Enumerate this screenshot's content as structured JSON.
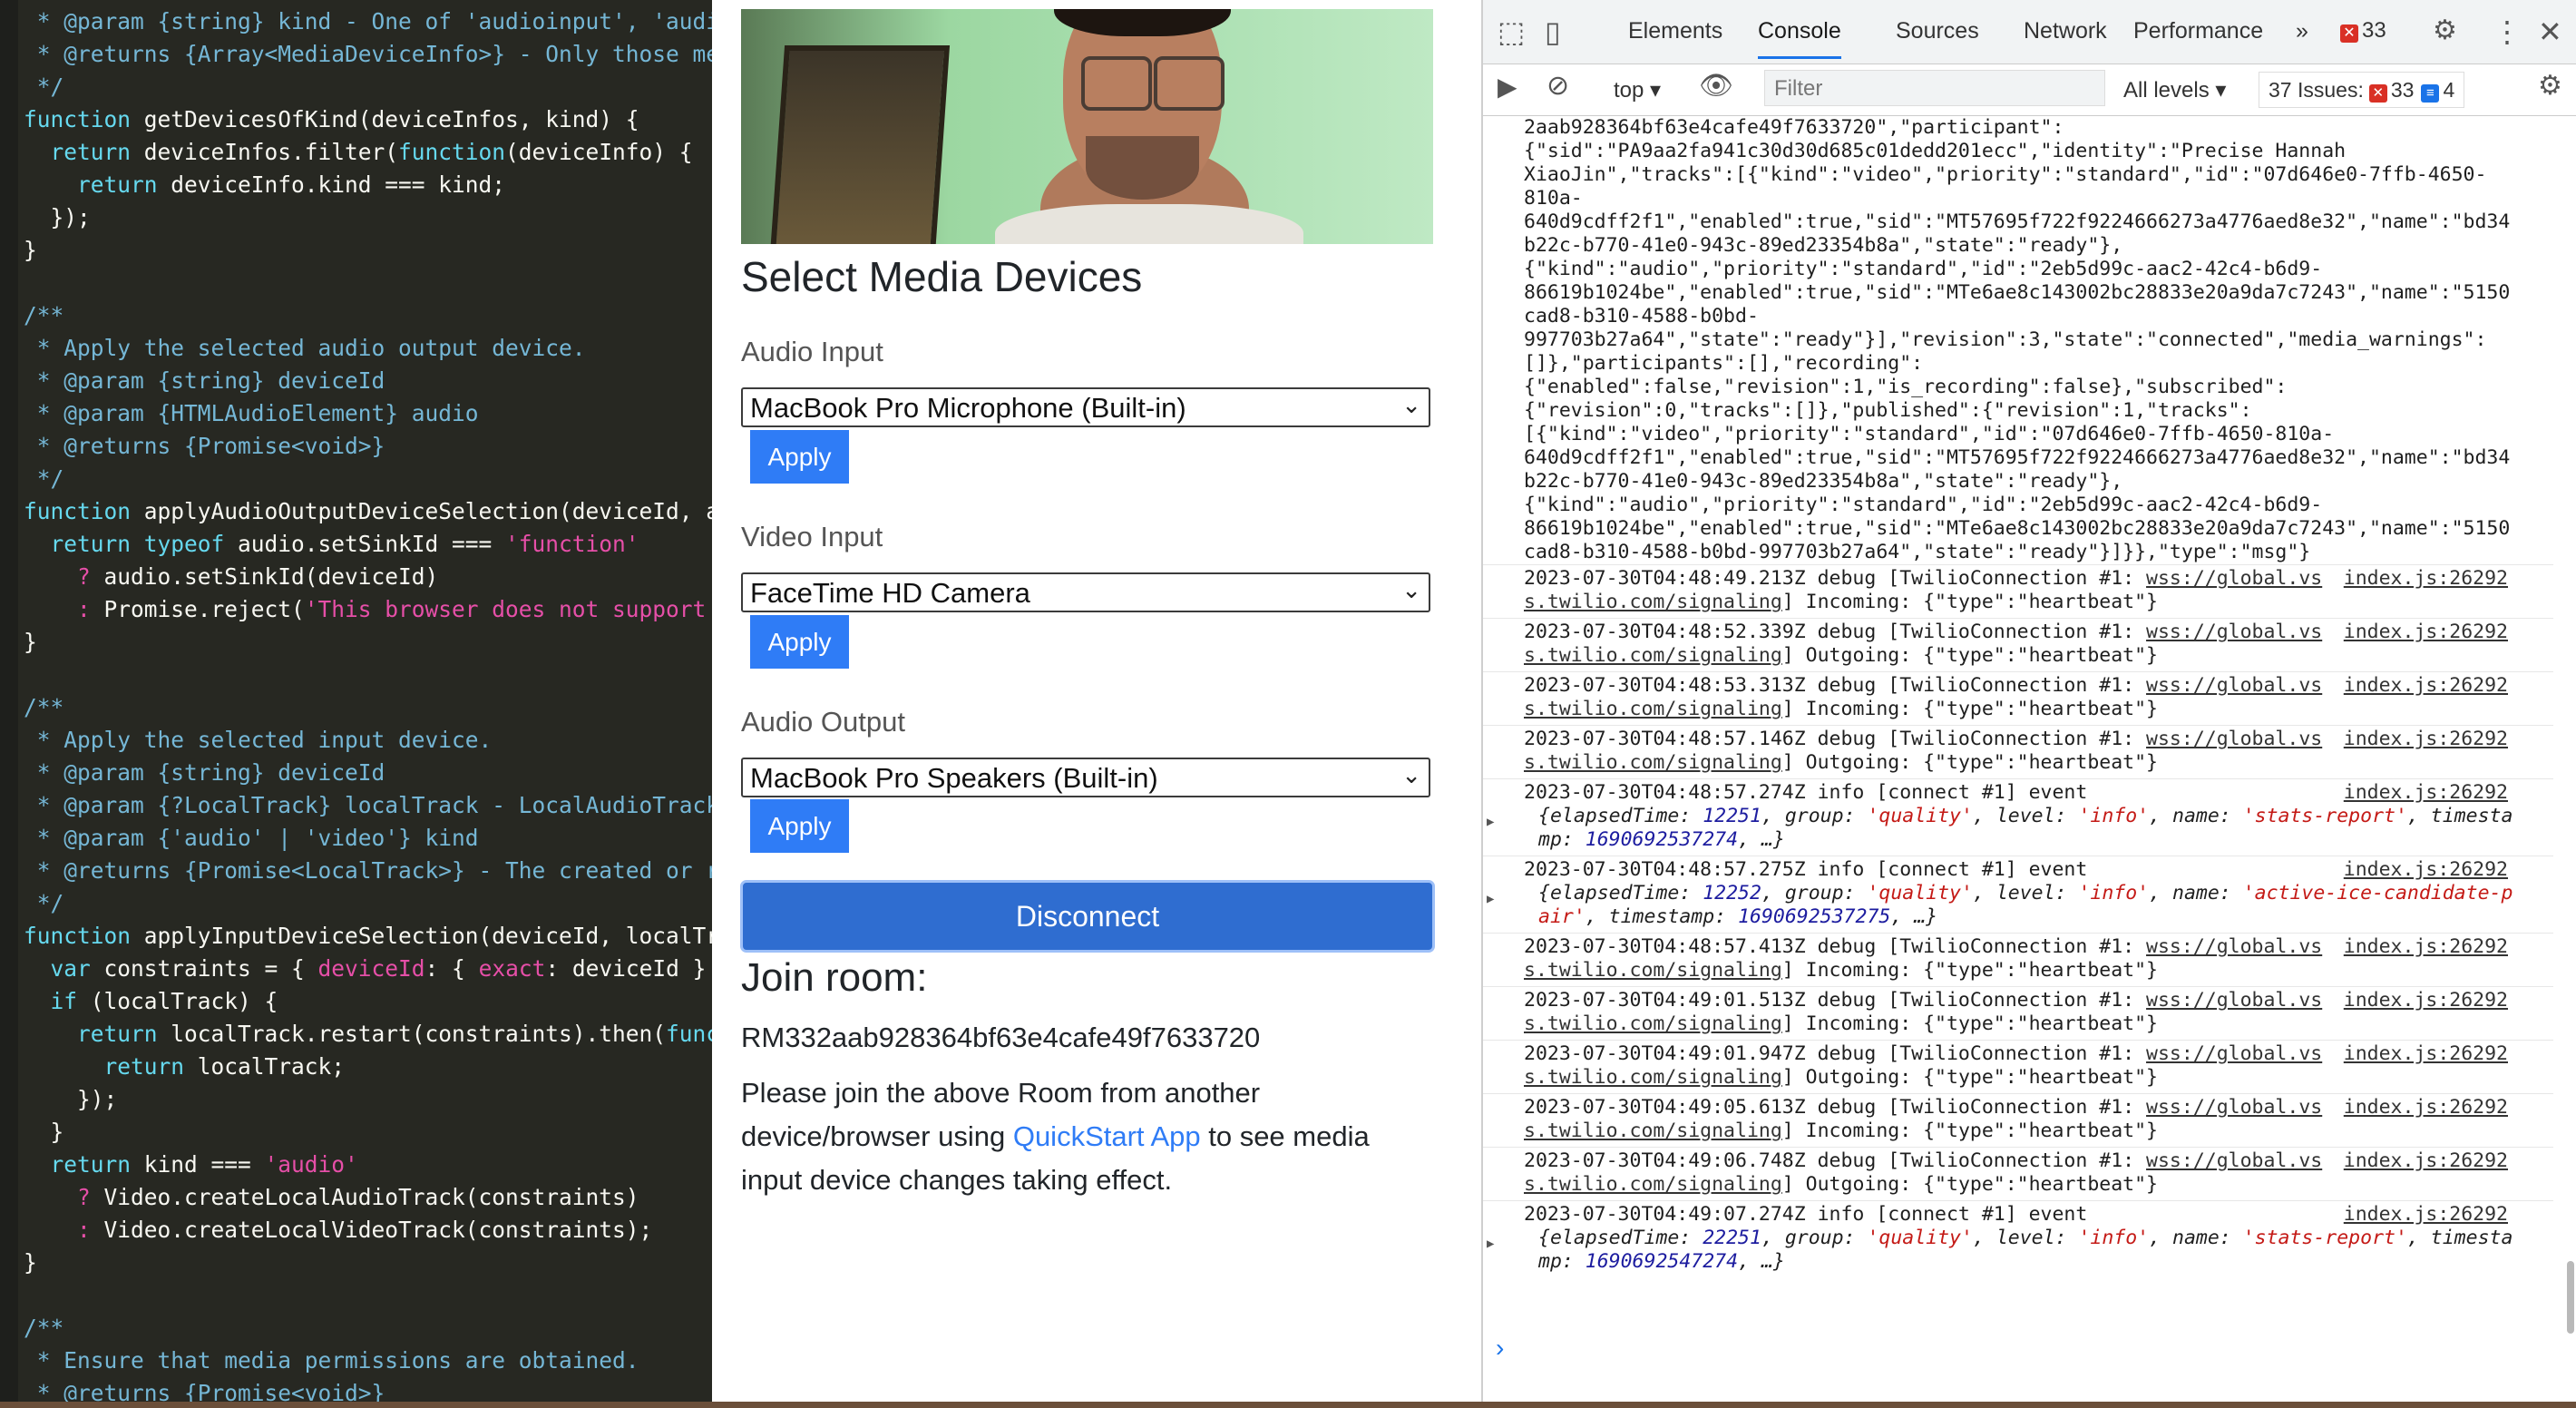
{
  "code": {
    "lines": [
      [
        [
          "c-com",
          " * @param {string} kind - One of 'audioinput', 'audi"
        ]
      ],
      [
        [
          "c-com",
          " * @returns {Array<MediaDeviceInfo>} - Only those me"
        ]
      ],
      [
        [
          "c-com",
          " */"
        ]
      ],
      [
        [
          "c-kw",
          "function "
        ],
        [
          "c-fn",
          "getDevicesOfKind(deviceInfos, kind) {"
        ]
      ],
      [
        [
          "c-kw",
          "  return "
        ],
        [
          "c-fn",
          "deviceInfos.filter("
        ],
        [
          "c-kw",
          "function"
        ],
        [
          "c-fn",
          "(deviceInfo) {"
        ]
      ],
      [
        [
          "c-kw",
          "    return "
        ],
        [
          "c-fn",
          "deviceInfo.kind === kind;"
        ]
      ],
      [
        [
          "c-fn",
          "  });"
        ]
      ],
      [
        [
          "c-fn",
          "}"
        ]
      ],
      [
        [
          "c-fn",
          ""
        ]
      ],
      [
        [
          "c-com",
          "/**"
        ]
      ],
      [
        [
          "c-com",
          " * Apply the selected audio output device."
        ]
      ],
      [
        [
          "c-com",
          " * @param {string} deviceId"
        ]
      ],
      [
        [
          "c-com",
          " * @param {HTMLAudioElement} audio"
        ]
      ],
      [
        [
          "c-com",
          " * @returns {Promise<void>}"
        ]
      ],
      [
        [
          "c-com",
          " */"
        ]
      ],
      [
        [
          "c-kw",
          "function "
        ],
        [
          "c-fn",
          "applyAudioOutputDeviceSelection(deviceId, a"
        ]
      ],
      [
        [
          "c-kw",
          "  return typeof "
        ],
        [
          "c-fn",
          "audio.setSinkId === "
        ],
        [
          "c-str",
          "'function'"
        ]
      ],
      [
        [
          "c-str",
          "    ? "
        ],
        [
          "c-fn",
          "audio.setSinkId(deviceId)"
        ]
      ],
      [
        [
          "c-str",
          "    : "
        ],
        [
          "c-fn",
          "Promise.reject("
        ],
        [
          "c-str",
          "'This browser does not support"
        ]
      ],
      [
        [
          "c-fn",
          "}"
        ]
      ],
      [
        [
          "c-fn",
          ""
        ]
      ],
      [
        [
          "c-com",
          "/**"
        ]
      ],
      [
        [
          "c-com",
          " * Apply the selected input device."
        ]
      ],
      [
        [
          "c-com",
          " * @param {string} deviceId"
        ]
      ],
      [
        [
          "c-com",
          " * @param {?LocalTrack} localTrack - LocalAudioTrack"
        ]
      ],
      [
        [
          "c-com",
          " * @param {'audio' | 'video'} kind"
        ]
      ],
      [
        [
          "c-com",
          " * @returns {Promise<LocalTrack>} - The created or r"
        ]
      ],
      [
        [
          "c-com",
          " */"
        ]
      ],
      [
        [
          "c-kw",
          "function "
        ],
        [
          "c-fn",
          "applyInputDeviceSelection(deviceId, localTr"
        ]
      ],
      [
        [
          "c-kw",
          "  var "
        ],
        [
          "c-fn",
          "constraints = { "
        ],
        [
          "c-str",
          "deviceId"
        ],
        [
          "c-fn",
          ": { "
        ],
        [
          "c-str",
          "exact"
        ],
        [
          "c-fn",
          ": deviceId }"
        ]
      ],
      [
        [
          "c-kw",
          "  if "
        ],
        [
          "c-fn",
          "(localTrack) {"
        ]
      ],
      [
        [
          "c-kw",
          "    return "
        ],
        [
          "c-fn",
          "localTrack.restart(constraints).then("
        ],
        [
          "c-kw",
          "func"
        ]
      ],
      [
        [
          "c-kw",
          "      return "
        ],
        [
          "c-fn",
          "localTrack;"
        ]
      ],
      [
        [
          "c-fn",
          "    });"
        ]
      ],
      [
        [
          "c-fn",
          "  }"
        ]
      ],
      [
        [
          "c-kw",
          "  return "
        ],
        [
          "c-fn",
          "kind === "
        ],
        [
          "c-str",
          "'audio'"
        ]
      ],
      [
        [
          "c-str",
          "    ? "
        ],
        [
          "c-fn",
          "Video.createLocalAudioTrack(constraints)"
        ]
      ],
      [
        [
          "c-str",
          "    : "
        ],
        [
          "c-fn",
          "Video.createLocalVideoTrack(constraints);"
        ]
      ],
      [
        [
          "c-fn",
          "}"
        ]
      ],
      [
        [
          "c-fn",
          ""
        ]
      ],
      [
        [
          "c-com",
          "/**"
        ]
      ],
      [
        [
          "c-com",
          " * Ensure that media permissions are obtained."
        ]
      ],
      [
        [
          "c-com",
          " * @returns {Promise<void>}"
        ]
      ]
    ]
  },
  "app": {
    "heading": "Select Media Devices",
    "audio_input": {
      "label": "Audio Input",
      "selected": "MacBook Pro Microphone (Built-in)",
      "apply": "Apply"
    },
    "video_input": {
      "label": "Video Input",
      "selected": "FaceTime HD Camera",
      "apply": "Apply"
    },
    "audio_output": {
      "label": "Audio Output",
      "selected": "MacBook Pro Speakers (Built-in)",
      "apply": "Apply"
    },
    "disconnect": "Disconnect",
    "join_heading": "Join room:",
    "room_id": "RM332aab928364bf63e4cafe49f7633720",
    "join_text_before": "Please join the above Room from another device/browser using ",
    "join_link": "QuickStart App",
    "join_text_after": " to see media input device changes taking effect."
  },
  "devtools": {
    "tabs": [
      "Elements",
      "Console",
      "Sources",
      "Network",
      "Performance"
    ],
    "active_tab": "Console",
    "more": "»",
    "error_count": "33",
    "context": "top",
    "filter_placeholder": "Filter",
    "levels": "All levels",
    "issues_label": "37 Issues:",
    "issues_errors": "33",
    "issues_messages": "4",
    "prompt": "›",
    "json_block": [
      "2aab928364bf63e4cafe49f7633720\",\"participant\":",
      "{\"sid\":\"PA9aa2fa941c30d30d685c01dedd201ecc\",\"identity\":\"Precise Hannah",
      "XiaoJin\",\"tracks\":[{\"kind\":\"video\",\"priority\":\"standard\",\"id\":\"07d646e0-7ffb-4650-",
      "810a-",
      "640d9cdff2f1\",\"enabled\":true,\"sid\":\"MT57695f722f9224666273a4776aed8e32\",\"name\":\"bd34",
      "b22c-b770-41e0-943c-89ed23354b8a\",\"state\":\"ready\"},",
      "{\"kind\":\"audio\",\"priority\":\"standard\",\"id\":\"2eb5d99c-aac2-42c4-b6d9-",
      "86619b1024be\",\"enabled\":true,\"sid\":\"MTe6ae8c143002bc28833e20a9da7c7243\",\"name\":\"5150",
      "cad8-b310-4588-b0bd-",
      "997703b27a64\",\"state\":\"ready\"}],\"revision\":3,\"state\":\"connected\",\"media_warnings\":",
      "[]},\"participants\":[],\"recording\":",
      "{\"enabled\":false,\"revision\":1,\"is_recording\":false},\"subscribed\":",
      "{\"revision\":0,\"tracks\":[]},\"published\":{\"revision\":1,\"tracks\":",
      "[{\"kind\":\"video\",\"priority\":\"standard\",\"id\":\"07d646e0-7ffb-4650-810a-",
      "640d9cdff2f1\",\"enabled\":true,\"sid\":\"MT57695f722f9224666273a4776aed8e32\",\"name\":\"bd34",
      "b22c-b770-41e0-943c-89ed23354b8a\",\"state\":\"ready\"},",
      "{\"kind\":\"audio\",\"priority\":\"standard\",\"id\":\"2eb5d99c-aac2-42c4-b6d9-",
      "86619b1024be\",\"enabled\":true,\"sid\":\"MTe6ae8c143002bc28833e20a9da7c7243\",\"name\":\"5150",
      "cad8-b310-4588-b0bd-997703b27a64\",\"state\":\"ready\"}]}},\"type\":\"msg\"}"
    ],
    "source": "index.js:26292",
    "messages": [
      {
        "kind": "debug",
        "l1": "2023-07-30T04:48:49.213Z debug [TwilioConnection #1: ",
        "u1": "wss://global.vs",
        "u2": "s.twilio.com/signaling",
        "l2": "] Incoming: {\"type\":\"heartbeat\"}"
      },
      {
        "kind": "debug",
        "l1": "2023-07-30T04:48:52.339Z debug [TwilioConnection #1: ",
        "u1": "wss://global.vs",
        "u2": "s.twilio.com/signaling",
        "l2": "] Outgoing: {\"type\":\"heartbeat\"}"
      },
      {
        "kind": "debug",
        "l1": "2023-07-30T04:48:53.313Z debug [TwilioConnection #1: ",
        "u1": "wss://global.vs",
        "u2": "s.twilio.com/signaling",
        "l2": "] Incoming: {\"type\":\"heartbeat\"}"
      },
      {
        "kind": "debug",
        "l1": "2023-07-30T04:48:57.146Z debug [TwilioConnection #1: ",
        "u1": "wss://global.vs",
        "u2": "s.twilio.com/signaling",
        "l2": "] Outgoing: {\"type\":\"heartbeat\"}"
      },
      {
        "kind": "info",
        "l1": "2023-07-30T04:48:57.274Z info [connect #1] event",
        "o1": [
          [
            "k",
            "{elapsedTime: "
          ],
          [
            "n",
            "12251"
          ],
          [
            "k",
            ", group: "
          ],
          [
            "s",
            "'quality'"
          ],
          [
            "k",
            ", level: "
          ],
          [
            "s",
            "'info'"
          ],
          [
            "k",
            ", name: "
          ],
          [
            "s",
            "'stats-report'"
          ],
          [
            "k",
            ", timesta"
          ]
        ],
        "o2": [
          [
            "k",
            "mp: "
          ],
          [
            "n",
            "1690692537274"
          ],
          [
            "k",
            ", …}"
          ]
        ]
      },
      {
        "kind": "info",
        "l1": "2023-07-30T04:48:57.275Z info [connect #1] event",
        "o1": [
          [
            "k",
            "{elapsedTime: "
          ],
          [
            "n",
            "12252"
          ],
          [
            "k",
            ", group: "
          ],
          [
            "s",
            "'quality'"
          ],
          [
            "k",
            ", level: "
          ],
          [
            "s",
            "'info'"
          ],
          [
            "k",
            ", name: "
          ],
          [
            "s",
            "'active-ice-candidate-p"
          ]
        ],
        "o2": [
          [
            "s",
            "air'"
          ],
          [
            "k",
            ", timestamp: "
          ],
          [
            "n",
            "1690692537275"
          ],
          [
            "k",
            ", …}"
          ]
        ]
      },
      {
        "kind": "debug",
        "l1": "2023-07-30T04:48:57.413Z debug [TwilioConnection #1: ",
        "u1": "wss://global.vs",
        "u2": "s.twilio.com/signaling",
        "l2": "] Incoming: {\"type\":\"heartbeat\"}"
      },
      {
        "kind": "debug",
        "l1": "2023-07-30T04:49:01.513Z debug [TwilioConnection #1: ",
        "u1": "wss://global.vs",
        "u2": "s.twilio.com/signaling",
        "l2": "] Incoming: {\"type\":\"heartbeat\"}"
      },
      {
        "kind": "debug",
        "l1": "2023-07-30T04:49:01.947Z debug [TwilioConnection #1: ",
        "u1": "wss://global.vs",
        "u2": "s.twilio.com/signaling",
        "l2": "] Outgoing: {\"type\":\"heartbeat\"}"
      },
      {
        "kind": "debug",
        "l1": "2023-07-30T04:49:05.613Z debug [TwilioConnection #1: ",
        "u1": "wss://global.vs",
        "u2": "s.twilio.com/signaling",
        "l2": "] Incoming: {\"type\":\"heartbeat\"}"
      },
      {
        "kind": "debug",
        "l1": "2023-07-30T04:49:06.748Z debug [TwilioConnection #1: ",
        "u1": "wss://global.vs",
        "u2": "s.twilio.com/signaling",
        "l2": "] Outgoing: {\"type\":\"heartbeat\"}"
      },
      {
        "kind": "info",
        "l1": "2023-07-30T04:49:07.274Z info [connect #1] event",
        "o1": [
          [
            "k",
            "{elapsedTime: "
          ],
          [
            "n",
            "22251"
          ],
          [
            "k",
            ", group: "
          ],
          [
            "s",
            "'quality'"
          ],
          [
            "k",
            ", level: "
          ],
          [
            "s",
            "'info'"
          ],
          [
            "k",
            ", name: "
          ],
          [
            "s",
            "'stats-report'"
          ],
          [
            "k",
            ", timesta"
          ]
        ],
        "o2": [
          [
            "k",
            "mp: "
          ],
          [
            "n",
            "1690692547274"
          ],
          [
            "k",
            ", …}"
          ]
        ]
      }
    ]
  }
}
